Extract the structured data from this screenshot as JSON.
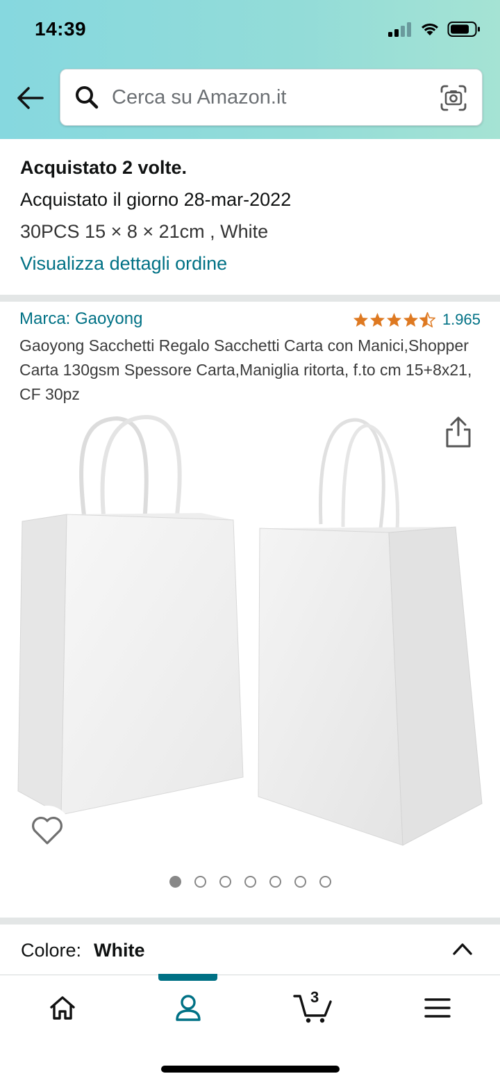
{
  "status_bar": {
    "time": "14:39"
  },
  "search": {
    "placeholder": "Cerca su Amazon.it"
  },
  "purchase": {
    "count_text": "Acquistato 2 volte.",
    "date_text": "Acquistato il giorno 28-mar-2022",
    "variant_text": "30PCS 15 × 8 × 21cm , White",
    "details_link": "Visualizza dettagli ordine"
  },
  "product": {
    "brand": "Marca: Gaoyong",
    "rating": 4.5,
    "rating_count": "1.965",
    "title": "Gaoyong Sacchetti Regalo Sacchetti Carta con Manici,Shopper Carta 130gsm Spessore Carta,Maniglia ritorta, f.to cm 15+8x21, CF 30pz",
    "image_count": 7,
    "active_image": 1
  },
  "color": {
    "label": "Colore:",
    "value": "White"
  },
  "tabbar": {
    "cart_count": "3",
    "tabs": [
      {
        "icon": "home-icon"
      },
      {
        "icon": "user-icon"
      },
      {
        "icon": "cart-icon"
      },
      {
        "icon": "menu-icon"
      }
    ]
  },
  "colors": {
    "accent": "#007185",
    "star": "#de7921",
    "header": "#8fdad9"
  }
}
